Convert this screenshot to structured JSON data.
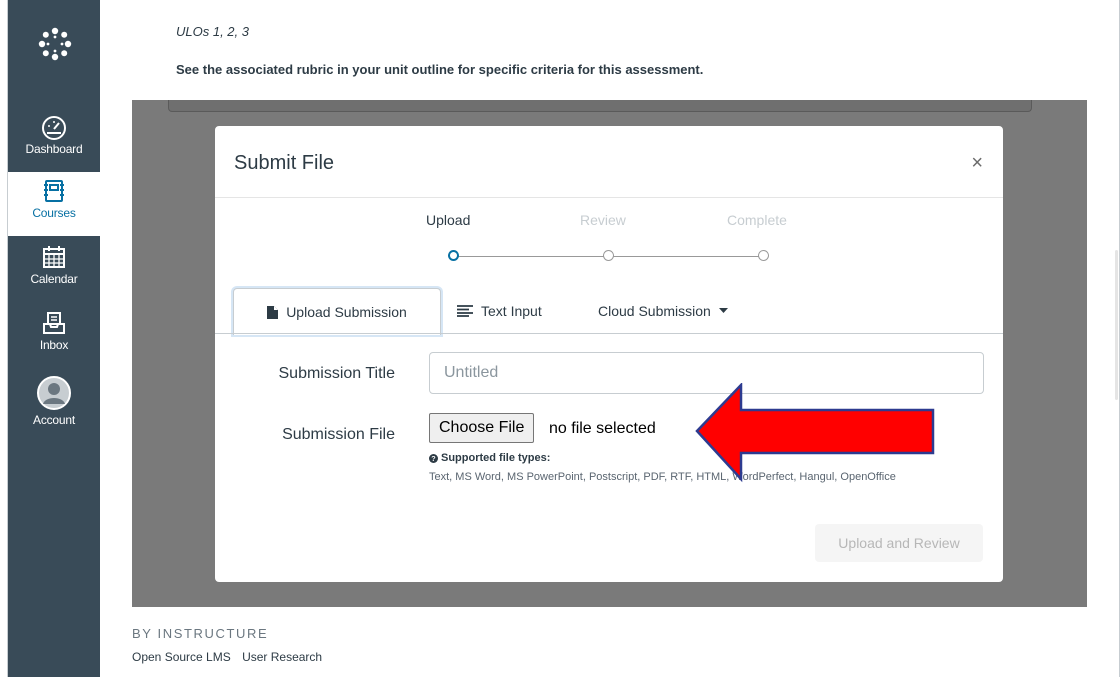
{
  "sidebar": {
    "items": [
      {
        "label": "Dashboard",
        "icon": "dashboard-icon"
      },
      {
        "label": "Courses",
        "icon": "courses-icon"
      },
      {
        "label": "Calendar",
        "icon": "calendar-icon"
      },
      {
        "label": "Inbox",
        "icon": "inbox-icon"
      },
      {
        "label": "Account",
        "icon": "account-icon"
      }
    ],
    "active": "Courses"
  },
  "content": {
    "ulos": "ULOs 1, 2, 3",
    "rubric_note": "See the associated rubric in your unit outline for specific criteria for this assessment."
  },
  "modal": {
    "title": "Submit File",
    "close_symbol": "×",
    "steps": [
      "Upload",
      "Review",
      "Complete"
    ],
    "current_step": "Upload",
    "tabs": [
      {
        "label": "Upload Submission",
        "icon": "file-icon"
      },
      {
        "label": "Text Input",
        "icon": "text-align-icon"
      },
      {
        "label": "Cloud Submission",
        "icon": "caret-down-icon"
      }
    ],
    "submission_title_label": "Submission Title",
    "submission_title_placeholder": "Untitled",
    "submission_file_label": "Submission File",
    "choose_file_label": "Choose File",
    "no_file_text": "no file selected",
    "supported_label": "Supported file types:",
    "supported_types": "Text, MS Word, MS PowerPoint, Postscript, PDF, RTF, HTML, WordPerfect, Hangul, OpenOffice",
    "upload_button": "Upload and Review"
  },
  "footer": {
    "brand": "BY INSTRUCTURE",
    "links": [
      "Open Source LMS",
      "User Research"
    ]
  },
  "colors": {
    "sidebar": "#394b58",
    "active_link": "#0770a3",
    "step_active": "#0770a3",
    "arrow": "#ff0000"
  }
}
